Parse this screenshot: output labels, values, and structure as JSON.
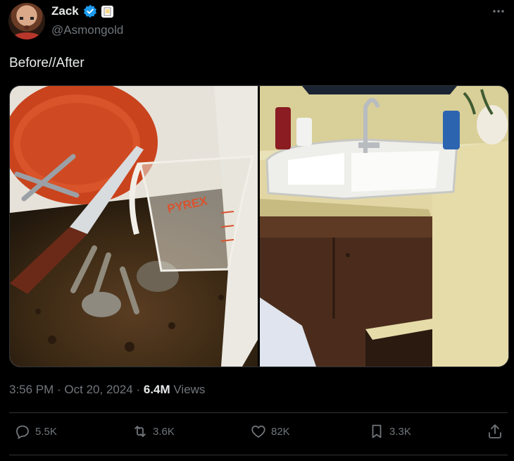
{
  "author": {
    "display_name": "Zack",
    "handle": "@Asmongold",
    "verified": true
  },
  "tweet": {
    "text": "Before//After"
  },
  "meta": {
    "time": "3:56 PM",
    "separator": " · ",
    "date": "Oct 20, 2024",
    "views_count": "6.4M",
    "views_label": " Views"
  },
  "actions": {
    "replies": "5.5K",
    "reposts": "3.6K",
    "likes": "82K",
    "bookmarks": "3.3K"
  },
  "photos": {
    "before_pyrex_text": "PYREX"
  },
  "colors": {
    "background": "#000000",
    "text": "#e7e9ea",
    "muted": "#71767b",
    "verified": "#1d9bf0",
    "divider": "#2f3336"
  },
  "icons": {
    "more": "more-icon",
    "verified": "verified-badge-icon",
    "affiliate": "affiliate-badge-icon",
    "reply": "reply-icon",
    "repost": "repost-icon",
    "like": "like-icon",
    "bookmark": "bookmark-icon",
    "share": "share-icon"
  }
}
